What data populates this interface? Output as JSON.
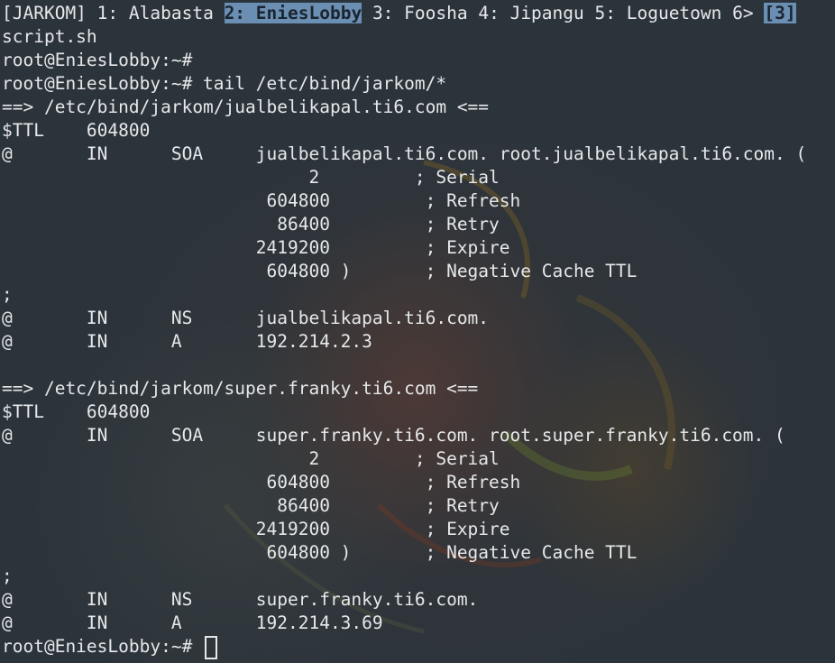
{
  "tabbar": {
    "session": "[JARKOM]",
    "tabs": [
      {
        "label": "1: Alabasta"
      },
      {
        "label": "2: EniesLobby"
      },
      {
        "label": "3: Foosha"
      },
      {
        "label": "4: Jipangu"
      },
      {
        "label": "5: Loguetown"
      },
      {
        "label": "6>"
      }
    ],
    "count": "[3]"
  },
  "lines": [
    "script.sh",
    "root@EniesLobby:~#",
    "root@EniesLobby:~# tail /etc/bind/jarkom/*",
    "==> /etc/bind/jarkom/jualbelikapal.ti6.com <==",
    "$TTL    604800",
    "@       IN      SOA     jualbelikapal.ti6.com. root.jualbelikapal.ti6.com. (",
    "                             2         ; Serial",
    "                         604800         ; Refresh",
    "                          86400         ; Retry",
    "                        2419200         ; Expire",
    "                         604800 )       ; Negative Cache TTL",
    ";",
    "@       IN      NS      jualbelikapal.ti6.com.",
    "@       IN      A       192.214.2.3",
    "",
    "==> /etc/bind/jarkom/super.franky.ti6.com <==",
    "$TTL    604800",
    "@       IN      SOA     super.franky.ti6.com. root.super.franky.ti6.com. (",
    "                             2         ; Serial",
    "                         604800         ; Refresh",
    "                          86400         ; Retry",
    "                        2419200         ; Expire",
    "                         604800 )       ; Negative Cache TTL",
    ";",
    "@       IN      NS      super.franky.ti6.com.",
    "@       IN      A       192.214.3.69"
  ],
  "prompt": "root@EniesLobby:~# ",
  "colors": {
    "background": "#303941",
    "foreground": "#e6e8ea",
    "active_tab": "#6b8fb3"
  }
}
